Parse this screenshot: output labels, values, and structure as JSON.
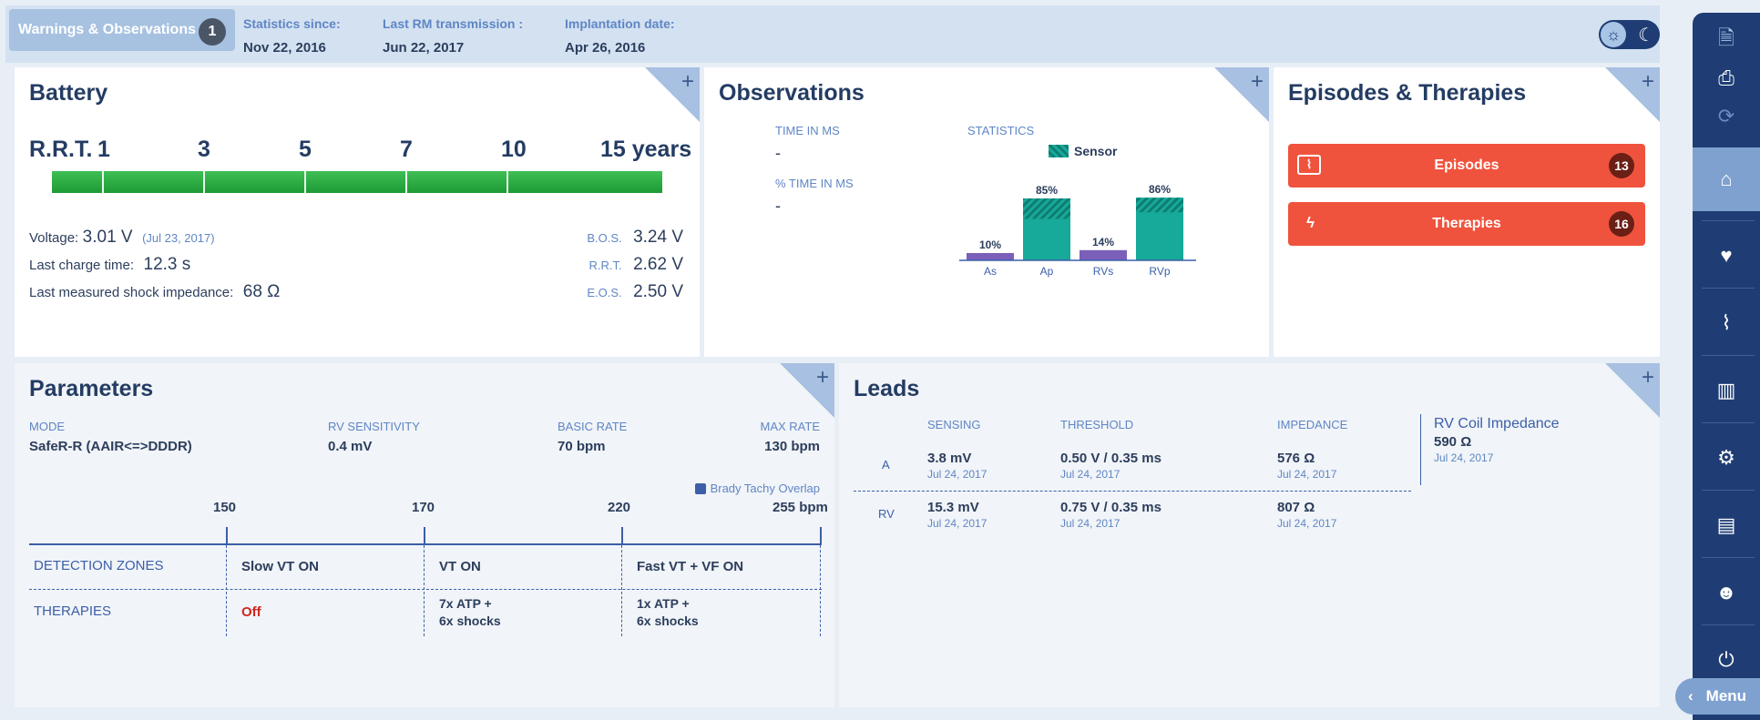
{
  "header": {
    "warnings_label": "Warnings & Observations",
    "warnings_count": "1",
    "stats": [
      {
        "label": "Statistics since:",
        "value": "Nov 22, 2016"
      },
      {
        "label": "Last RM transmission :",
        "value": "Jun 22, 2017"
      },
      {
        "label": "Implantation date:",
        "value": "Apr 26, 2016"
      }
    ]
  },
  "battery": {
    "title": "Battery",
    "rrt_label": "R.R.T.",
    "ticks": [
      "1",
      "3",
      "5",
      "7",
      "10",
      "15 years"
    ],
    "voltage_label": "Voltage:",
    "voltage_value": "3.01 V",
    "voltage_date": "(Jul 23, 2017)",
    "charge_label": "Last charge time:",
    "charge_value": "12.3 s",
    "impedance_label": "Last measured shock impedance:",
    "impedance_value": "68 Ω",
    "bos_label": "B.O.S.",
    "bos_value": "3.24 V",
    "rrt_label2": "R.R.T.",
    "rrt_value": "2.62 V",
    "eos_label": "E.O.S.",
    "eos_value": "2.50 V",
    "colors": {
      "bar": "#23a23a"
    }
  },
  "observations": {
    "title": "Observations",
    "time_label": "TIME IN MS",
    "time_value": "-",
    "pct_label": "% TIME IN MS",
    "pct_value": "-",
    "stats_label": "STATISTICS",
    "legend_label": "Sensor"
  },
  "chart_data": {
    "type": "bar",
    "categories": [
      "As",
      "Ap",
      "RVs",
      "RVp"
    ],
    "values": [
      10,
      85,
      14,
      86
    ],
    "value_labels": [
      "10%",
      "85%",
      "14%",
      "86%"
    ],
    "series": [
      {
        "name": "Sensor",
        "values": [
          0,
          28,
          0,
          20
        ]
      }
    ],
    "colors": {
      "sensed": "#7b5fb8",
      "paced": "#17a999"
    },
    "ylim": [
      0,
      100
    ]
  },
  "episodes": {
    "title": "Episodes & Therapies",
    "episodes_label": "Episodes",
    "episodes_count": "13",
    "therapies_label": "Therapies",
    "therapies_count": "16"
  },
  "parameters": {
    "title": "Parameters",
    "cols": [
      {
        "label": "MODE",
        "value": "SafeR-R (AAIR<=>DDDR)"
      },
      {
        "label": "RV SENSITIVITY",
        "value": "0.4 mV"
      },
      {
        "label": "BASIC RATE",
        "value": "70 bpm"
      },
      {
        "label": "MAX RATE",
        "value": "130 bpm"
      }
    ],
    "overlap_label": "Brady Tachy Overlap",
    "rate_ticks": [
      "150",
      "170",
      "220",
      "255 bpm"
    ],
    "zones_label": "DETECTION ZONES",
    "therapies_label": "THERAPIES",
    "zones": [
      "Slow VT ON",
      "VT ON",
      "Fast VT + VF ON"
    ],
    "therapies": [
      "Off",
      "7x ATP  +",
      "6x shocks",
      "1x ATP  +",
      "6x shocks"
    ]
  },
  "leads": {
    "title": "Leads",
    "headers": [
      "SENSING",
      "THRESHOLD",
      "IMPEDANCE"
    ],
    "rows": [
      {
        "name": "A",
        "sensing": "3.8 mV",
        "sensing_date": "Jul 24, 2017",
        "threshold": "0.50 V / 0.35 ms",
        "threshold_date": "Jul 24, 2017",
        "impedance": "576 Ω",
        "impedance_date": "Jul 24, 2017"
      },
      {
        "name": "RV",
        "sensing": "15.3 mV",
        "sensing_date": "Jul 24, 2017",
        "threshold": "0.75 V / 0.35 ms",
        "threshold_date": "Jul 24, 2017",
        "impedance": "807 Ω",
        "impedance_date": "Jul 24, 2017"
      }
    ],
    "coil_label": "RV Coil Impedance",
    "coil_value": "590 Ω",
    "coil_date": "Jul 24, 2017"
  },
  "sidebar": {
    "icons": [
      "document-icon",
      "print-icon",
      "sync-icon",
      "home-icon",
      "heart-icon",
      "ecg-icon",
      "stats-icon",
      "settings-icon",
      "report-icon",
      "user-icon",
      "power-icon"
    ],
    "menu_label": "Menu"
  }
}
